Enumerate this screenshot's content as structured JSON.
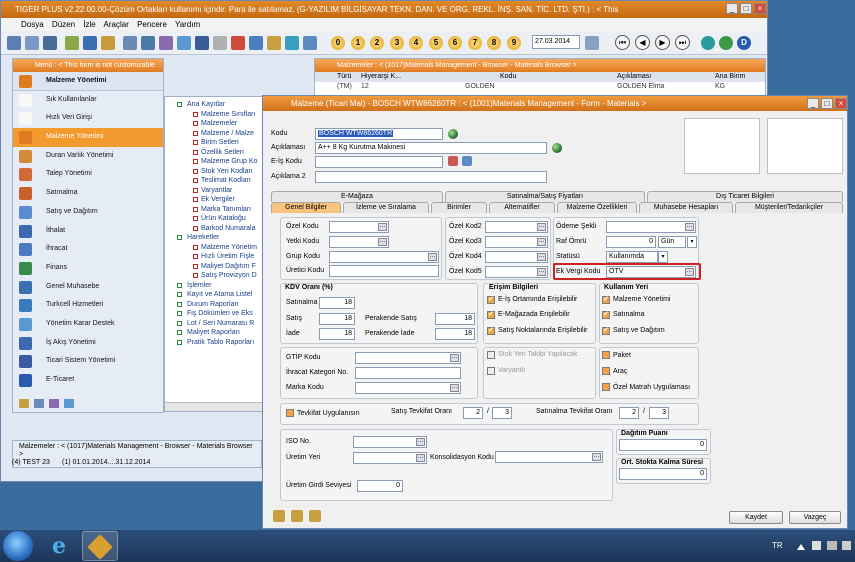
{
  "main_window": {
    "title": "TIGER PLUS v2.22.00.00-Çözüm Ortakları kullanımı içindir. Para ile satılamaz. (G-YAZILIM BİLGİSAYAR TEKN. DAN. VE ORG. REKL. İNŞ. SAN. TİC. LTD. ŞTİ.) : < This",
    "menu": [
      "Dosya",
      "Düzen",
      "İzle",
      "Araçlar",
      "Pencere",
      "Yardım"
    ],
    "toolbar_numbers": [
      "0",
      "1",
      "2",
      "3",
      "4",
      "5",
      "6",
      "7",
      "8",
      "9"
    ],
    "date": "27.03.2014"
  },
  "menu_panel": {
    "title": "Menü : < This form is not customizable with LOD >",
    "header": "Malzeme Yönetimi",
    "items": [
      {
        "label": "Sık Kullanılanlar",
        "color": "#f7f7f7"
      },
      {
        "label": "Hızlı Veri Girişi",
        "color": "#f7f7f7"
      },
      {
        "label": "Malzeme Yönetimi",
        "color": "#e07b20"
      },
      {
        "label": "Duran Varlık Yönetimi",
        "color": "#d08a3a"
      },
      {
        "label": "Talep Yönetimi",
        "color": "#d06a3a"
      },
      {
        "label": "Satınalma",
        "color": "#c8602a"
      },
      {
        "label": "Satış ve Dağıtım",
        "color": "#5a8ad0"
      },
      {
        "label": "İthalat",
        "color": "#3a6ab0"
      },
      {
        "label": "İhracat",
        "color": "#4a7ac0"
      },
      {
        "label": "Finans",
        "color": "#3a8a4a"
      },
      {
        "label": "Genel Muhasebe",
        "color": "#3a70b0"
      },
      {
        "label": "Turkcell Hizmetleri",
        "color": "#3a7ac0"
      },
      {
        "label": "Yönetim Karar Destek",
        "color": "#5a9ad0"
      },
      {
        "label": "İş Akış Yönetimi",
        "color": "#3a6ab0"
      },
      {
        "label": "Ticari Sistem Yönetimi",
        "color": "#3a5aa0"
      },
      {
        "label": "E-Ticaret",
        "color": "#2a5ab0"
      }
    ],
    "active_index": 2
  },
  "tree": {
    "items": [
      {
        "label": "Ana Kayıtlar",
        "indent": 1
      },
      {
        "label": "Malzeme Sınıfları",
        "indent": 2
      },
      {
        "label": "Malzemeler",
        "indent": 2
      },
      {
        "label": "Malzeme / Malze",
        "indent": 2
      },
      {
        "label": "Birim Setleri",
        "indent": 2
      },
      {
        "label": "Özellik Setleri",
        "indent": 2
      },
      {
        "label": "Malzeme Grup Ko",
        "indent": 2
      },
      {
        "label": "Stok Yeri Kodları",
        "indent": 2
      },
      {
        "label": "Teslimat Kodları",
        "indent": 2
      },
      {
        "label": "Varyantlar",
        "indent": 2
      },
      {
        "label": "Ek Vergiler",
        "indent": 2
      },
      {
        "label": "Marka Tanımları",
        "indent": 2
      },
      {
        "label": "Ürün Kataloğu",
        "indent": 2
      },
      {
        "label": "Barkod Numarala",
        "indent": 2
      },
      {
        "label": "Hareketler",
        "indent": 1
      },
      {
        "label": "Malzeme Yönetim",
        "indent": 2
      },
      {
        "label": "Hızlı Üretim Fişle",
        "indent": 2
      },
      {
        "label": "Maliyet Dağıtım F",
        "indent": 2
      },
      {
        "label": "Satış Provizyon D",
        "indent": 2
      },
      {
        "label": "İşlemler",
        "indent": 1
      },
      {
        "label": "Kayıt ve Atama Listel",
        "indent": 1
      },
      {
        "label": "Durum Raporları",
        "indent": 1
      },
      {
        "label": "Fiş Dökümleri ve Eks",
        "indent": 1
      },
      {
        "label": "Lot / Seri Numarası R",
        "indent": 1
      },
      {
        "label": "Maliyet Raporları",
        "indent": 1
      },
      {
        "label": "Pratik Tablo Raporları",
        "indent": 1
      }
    ]
  },
  "browser": {
    "title": "Malzemeler : < (1017)Materials Management - Browser - Materials Browser >",
    "columns": [
      "Türü",
      "Hiyerarşi K...",
      "Kodu",
      "Açıklaması",
      "Ana Birim"
    ],
    "row": [
      "(TM)",
      "12",
      "GOLDEN",
      "GOLDEN Elma",
      "KG"
    ]
  },
  "status": {
    "window_label": "Malzemeler : < (1017)Materials Management - Browser - Materials Browser >",
    "firm": "(4) TEST 23",
    "period": "(1) 01.01.2014....31.12.2014"
  },
  "form": {
    "title": "Malzeme (Ticari Mal) - BOSCH WTW86260TR : < (1001)Materials Management - Form - Materials >",
    "kodu_label": "Kodu",
    "kodu_value": "BOSCH WTW86260TR",
    "aciklama_label": "Açıklaması",
    "aciklama_value": "A++ 8 Kg Kurutma Makinesi",
    "eis_label": "E-İş Kodu",
    "aciklama2_label": "Açıklama 2",
    "tabs_row1": [
      "E-Mağaza",
      "Satınalma/Satış Fiyatları",
      "Dış Ticaret Bilgileri"
    ],
    "tabs_row2": [
      "Genel Bilgiler",
      "İzleme ve Sıralama",
      "Birimler",
      "Alternatifler",
      "Malzeme Özellikleri",
      "Muhasebe Hesapları",
      "Müşteriler/Tedarikçiler"
    ],
    "ozel_kodu": "Özel Kodu",
    "yetki_kodu": "Yetki Kodu",
    "grup_kodu": "Grup Kodu",
    "uretici_kodu": "Üretici Kodu",
    "ozel_kod2": "Özel Kod2",
    "ozel_kod3": "Özel Kod3",
    "ozel_kod4": "Özel Kod4",
    "ozel_kod5": "Özel Kod5",
    "odeme_sekli": "Ödeme Şekli",
    "raf_omru": "Raf Ömrü",
    "raf_omru_value": "0",
    "raf_omru_unit": "Gün",
    "statusu": "Statüsü",
    "statusu_value": "Kullanımda",
    "ek_vergi_kodu": "Ek Vergi Kodu",
    "ek_vergi_value": "ÖTV",
    "kdv_title": "KDV Oranı (%)",
    "satinalma": "Satınalma",
    "satinalma_v": "18",
    "satis": "Satış",
    "satis_v": "18",
    "iade": "İade",
    "iade_v": "18",
    "perakende_satis": "Perakende Satış",
    "perakende_satis_v": "18",
    "perakende_iade": "Perakende İade",
    "perakende_iade_v": "18",
    "erisim_title": "Erişim Bilgileri",
    "erisim": [
      "E-İş Ortamında Erişilebilir",
      "E-Mağazada Erişilebilir",
      "Satış Noktalarında Erişilebilir"
    ],
    "kullanim_title": "Kullanım Yeri",
    "kullanim": [
      "Malzeme Yönetimi",
      "Satınalma",
      "Satış ve Dağıtım"
    ],
    "gtip": "GTİP Kodu",
    "ihracat_kat": "İhracat Kategori No.",
    "marka": "Marka Kodu",
    "stok_yeri": "Stok Yeri Takibi Yapılacak",
    "varyantli": "Varyantlı",
    "paket": "Paket",
    "arac": "Araç",
    "ozel_matrah": "Özel Matrah Uygulaması",
    "tevkifat": "Tevkifat Uygulanısın",
    "satis_tevkifat": "Satış Tevkifat Oranı",
    "satis_tev_a": "2",
    "satis_tev_b": "3",
    "satinalma_tevkifat": "Satınalma Tevkifat Oranı",
    "sat_tev_a": "2",
    "sat_tev_b": "3",
    "iso": "ISO No.",
    "uretim_yeri": "Üretim Yeri",
    "konsolidasyon": "Konsolidasyon Kodu",
    "uretim_girdi": "Üretim Girdi Seviyesi",
    "uretim_girdi_v": "0",
    "dagitim_puani": "Dağıtım Puanı",
    "dagitim_v": "0",
    "ort_stokta": "Ort. Stokta Kalma Süresi",
    "ort_v": "0",
    "kaydet": "Kaydet",
    "vazgec": "Vazgeç",
    "separator": "/"
  },
  "taskbar": {
    "lang": "TR"
  },
  "colors": {
    "accent": "#f39a2e",
    "highlight_border": "#cc2222"
  }
}
